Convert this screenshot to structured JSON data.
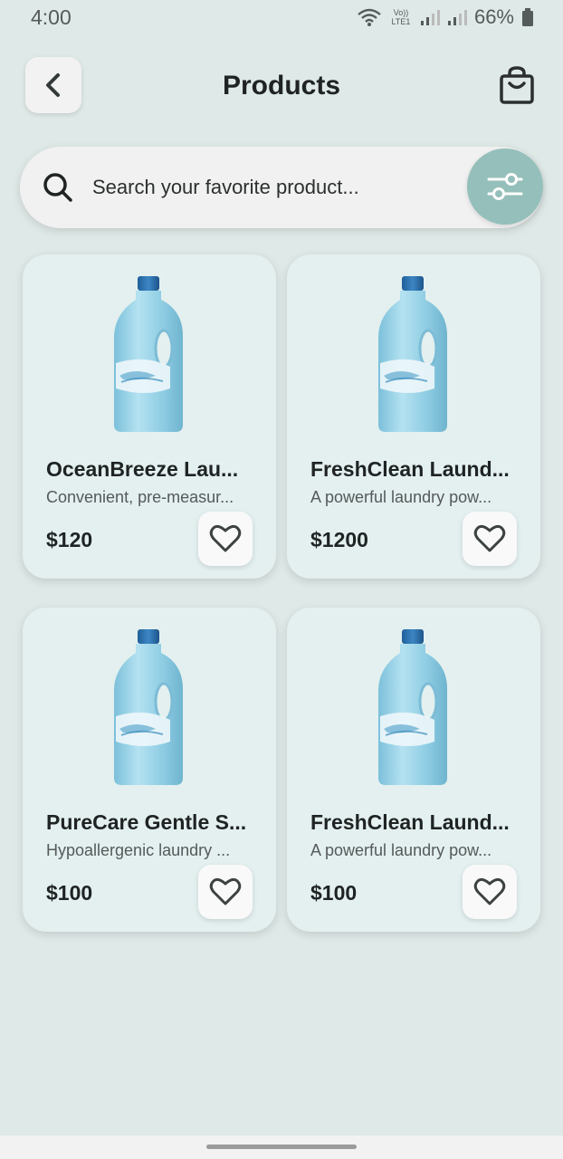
{
  "status": {
    "time": "4:00",
    "network": "Vo)) LTE1",
    "battery": "66%"
  },
  "header": {
    "title": "Products",
    "back_icon": "chevron-left-icon",
    "bag_icon": "shopping-bag-icon"
  },
  "search": {
    "placeholder": "Search your favorite product...",
    "value": "",
    "icon": "search-icon",
    "filter_icon": "sliders-icon"
  },
  "products": [
    {
      "name": "OceanBreeze Lau...",
      "description": "Convenient, pre-measur...",
      "price": "$120",
      "favorite": false
    },
    {
      "name": "FreshClean Laund...",
      "description": "A powerful laundry pow...",
      "price": "$1200",
      "favorite": false
    },
    {
      "name": "PureCare Gentle S...",
      "description": "Hypoallergenic laundry ...",
      "price": "$100",
      "favorite": false
    },
    {
      "name": "FreshClean Laund...",
      "description": "A powerful laundry pow...",
      "price": "$100",
      "favorite": false
    }
  ],
  "colors": {
    "background": "#dfe9e7",
    "card": "#e3f0ef",
    "accent": "#95bfba",
    "bottle": "#8fcde3"
  }
}
